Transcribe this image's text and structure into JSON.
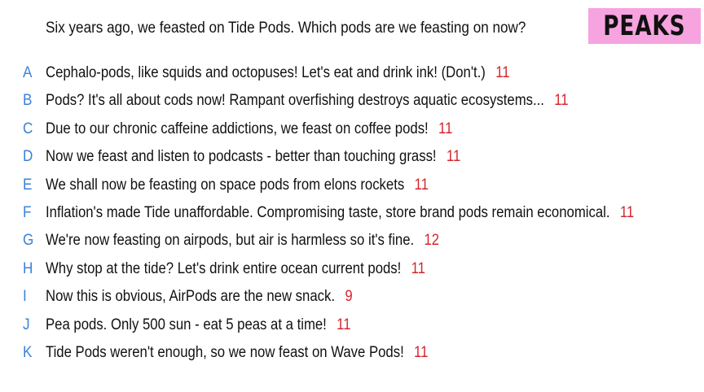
{
  "header": {
    "question": "Six years ago, we feasted on Tide Pods. Which pods are we feasting on now?",
    "badge": "PEAKS",
    "badge_color": "#f7a3df"
  },
  "colors": {
    "letter": "#3d7fd8",
    "count": "#d4262c",
    "text": "#111111"
  },
  "answers": [
    {
      "letter": "A",
      "text": "Cephalo-pods, like squids and octopuses! Let's eat and drink ink! (Don't.)",
      "count": "11"
    },
    {
      "letter": "B",
      "text": "Pods? It's all about cods now! Rampant overfishing destroys aquatic ecosystems...",
      "count": "11"
    },
    {
      "letter": "C",
      "text": "Due to our chronic caffeine addictions, we feast on coffee pods!",
      "count": "11"
    },
    {
      "letter": "D",
      "text": "Now we feast and listen to podcasts - better than touching grass!",
      "count": "11"
    },
    {
      "letter": "E",
      "text": "We shall now be feasting on space pods from elons rockets",
      "count": "11"
    },
    {
      "letter": "F",
      "text": "Inflation's made Tide unaffordable. Compromising taste, store brand pods remain economical.",
      "count": "11"
    },
    {
      "letter": "G",
      "text": "We're now feasting on airpods, but air is harmless so it's fine.",
      "count": "12"
    },
    {
      "letter": "H",
      "text": "Why stop at the tide? Let's drink entire ocean current pods!",
      "count": "11"
    },
    {
      "letter": "I",
      "text": "Now this is obvious, AirPods are the new snack.",
      "count": "9"
    },
    {
      "letter": "J",
      "text": "Pea pods. Only 500 sun - eat 5 peas at a time!",
      "count": "11"
    },
    {
      "letter": "K",
      "text": "Tide Pods weren't enough, so we now feast on Wave Pods!",
      "count": "11"
    }
  ]
}
